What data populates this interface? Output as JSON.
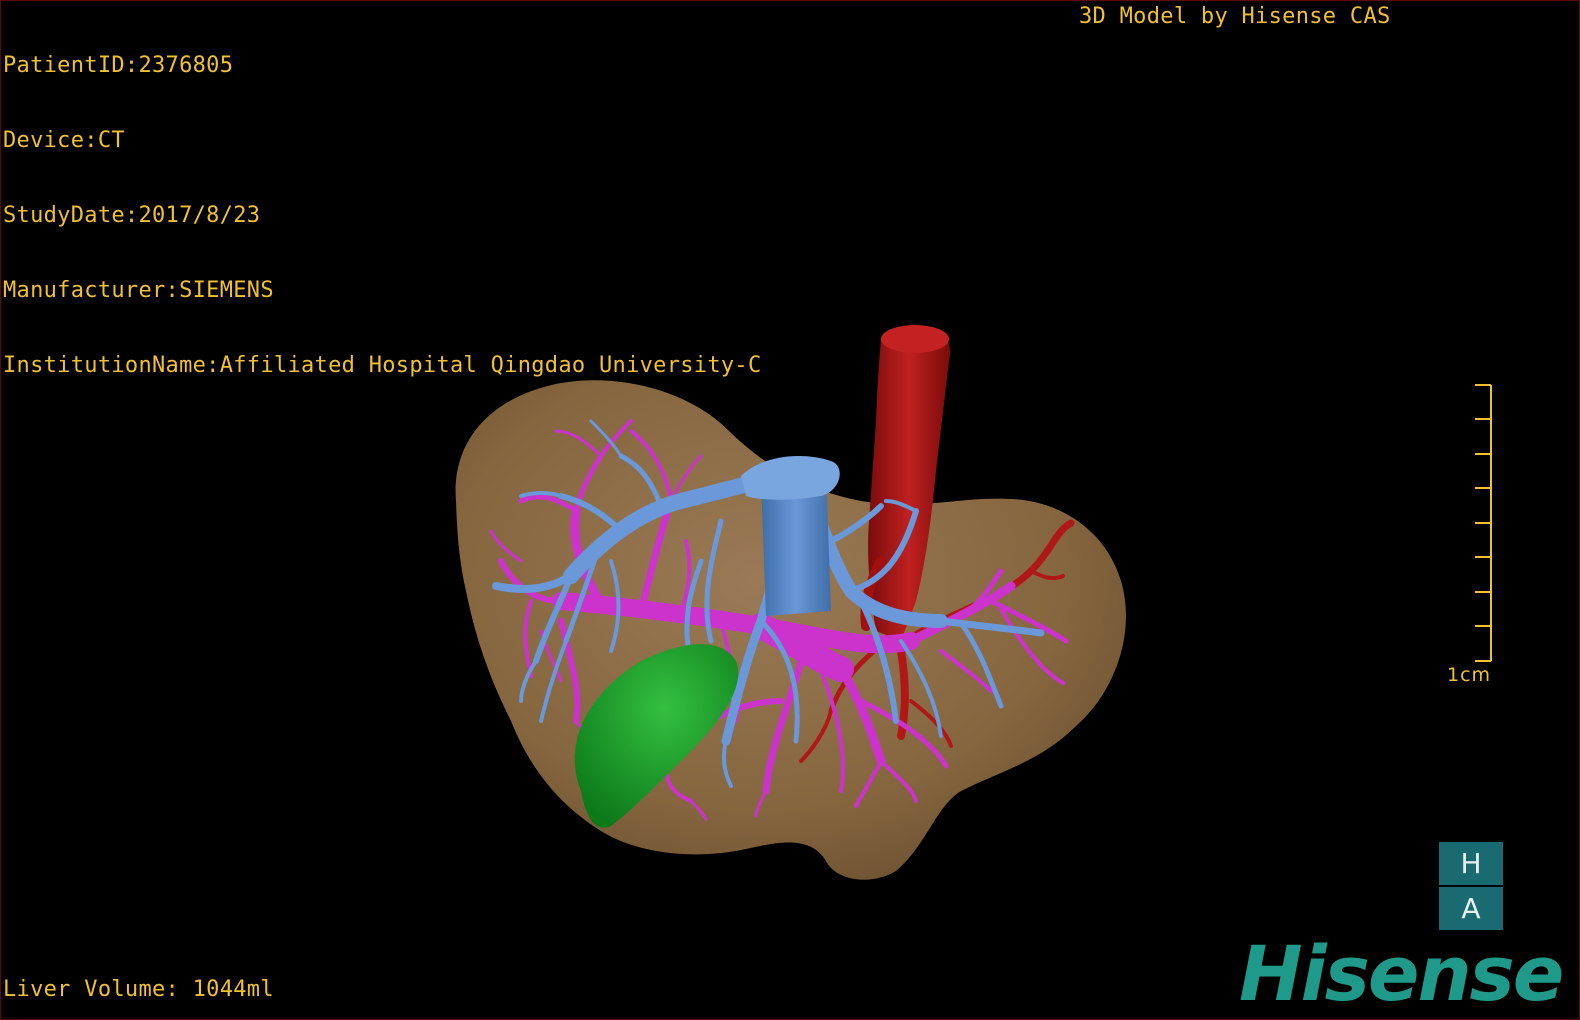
{
  "patient_info": {
    "patient_id": "PatientID:2376805",
    "device": "Device:CT",
    "study_date": "StudyDate:2017/8/23",
    "manufacturer": "Manufacturer:SIEMENS",
    "institution": "InstitutionName:Affiliated Hospital Qingdao University-C"
  },
  "credit": "3D Model by Hisense CAS",
  "liver_volume": "Liver Volume: 1044ml",
  "scale_bar": {
    "label": "1cm"
  },
  "orientation": {
    "top": "H",
    "bottom": "A"
  },
  "brand": "Hisense",
  "colors": {
    "text": "#f0c030",
    "liver": "#8a6b4a",
    "portal_vein": "#cc33cc",
    "hepatic_vein": "#6699dd",
    "artery_ivc": "#b01818",
    "gallbladder": "#1a9a2a",
    "brand": "#1f9a8a",
    "orientation_box": "#1a6a72"
  }
}
